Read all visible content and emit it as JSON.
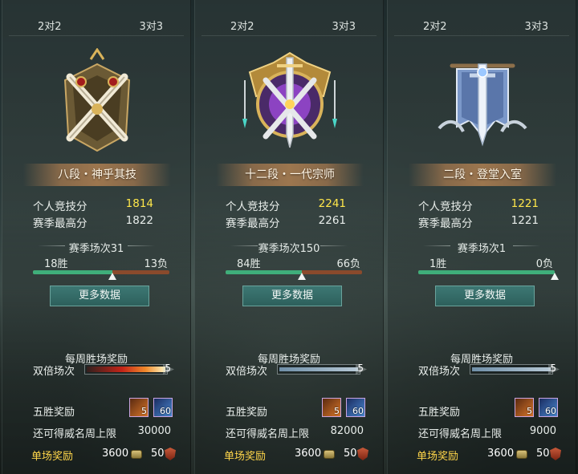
{
  "colors": {
    "score_highlight": "#ffe74a",
    "win_bar": "#3fae7a",
    "loss_bar": "#8a4a2c",
    "single_reward_label": "#ffd64a",
    "button_bg": "#2d605c"
  },
  "panels": [
    {
      "tab_2v2": "2对2",
      "tab_3v3": "3对3",
      "emblem_icon": "bronze-crossed-swords-emblem-icon",
      "rank_name": "八段・神乎其技",
      "personal_score_label": "个人竞技分",
      "personal_score": "1814",
      "season_best_label": "赛季最高分",
      "season_best": "1822",
      "season_matches": "赛季场次31",
      "wins": "18胜",
      "losses": "13负",
      "win_ratio": 0.58,
      "more_data_button": "更多数据",
      "weekly_reward_title": "每周胜场奖励",
      "double_label": "双倍场次",
      "double_progress": 1.0,
      "double_hot": true,
      "double_count": "5",
      "five_win_label": "五胜奖励",
      "item1_count": "5",
      "item2_count": "60",
      "weekly_cap_label": "还可得威名周上限",
      "weekly_cap": "30000",
      "single_reward_label": "单场奖励",
      "coin_reward": "3600",
      "badge_reward": "50"
    },
    {
      "tab_2v2": "2对2",
      "tab_3v3": "3对3",
      "emblem_icon": "purple-gold-sword-emblem-icon",
      "rank_name": "十二段・一代宗师",
      "personal_score_label": "个人竞技分",
      "personal_score": "2241",
      "season_best_label": "赛季最高分",
      "season_best": "2261",
      "season_matches": "赛季场次150",
      "wins": "84胜",
      "losses": "66负",
      "win_ratio": 0.56,
      "more_data_button": "更多数据",
      "weekly_reward_title": "每周胜场奖励",
      "double_label": "双倍场次",
      "double_progress": 1.0,
      "double_hot": false,
      "double_count": "5",
      "five_win_label": "五胜奖励",
      "item1_count": "5",
      "item2_count": "60",
      "weekly_cap_label": "还可得威名周上限",
      "weekly_cap": "82000",
      "single_reward_label": "单场奖励",
      "coin_reward": "3600",
      "badge_reward": "50"
    },
    {
      "tab_2v2": "2对2",
      "tab_3v3": "3对3",
      "emblem_icon": "silver-banner-sword-emblem-icon",
      "rank_name": "二段・登堂入室",
      "personal_score_label": "个人竞技分",
      "personal_score": "1221",
      "season_best_label": "赛季最高分",
      "season_best": "1221",
      "season_matches": "赛季场次1",
      "wins": "1胜",
      "losses": "0负",
      "win_ratio": 1.0,
      "more_data_button": "更多数据",
      "weekly_reward_title": "每周胜场奖励",
      "double_label": "双倍场次",
      "double_progress": 1.0,
      "double_hot": false,
      "double_count": "5",
      "five_win_label": "五胜奖励",
      "item1_count": "5",
      "item2_count": "60",
      "weekly_cap_label": "还可得威名周上限",
      "weekly_cap": "9000",
      "single_reward_label": "单场奖励",
      "coin_reward": "3600",
      "badge_reward": "50"
    }
  ]
}
